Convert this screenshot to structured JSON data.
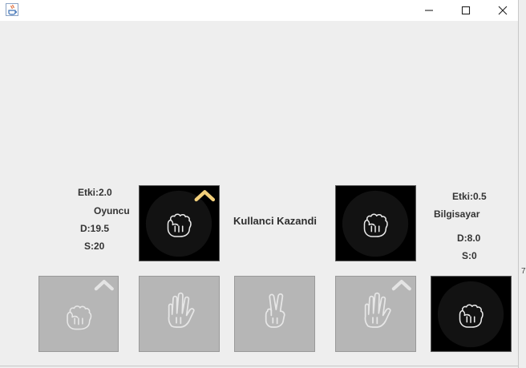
{
  "window": {
    "app_icon": "java-cup-icon",
    "controls": [
      "minimize-icon",
      "maximize-icon",
      "close-icon"
    ]
  },
  "player": {
    "effect": "Etki:2.0",
    "name": "Oyuncu",
    "durability": "D:19.5",
    "strength": "S:20",
    "card": "rock-hand-icon"
  },
  "computer": {
    "effect": "Etki:0.5",
    "name": "Bilgisayar",
    "durability": "D:8.0",
    "strength": "S:0",
    "card": "rock-hand-icon"
  },
  "result": "Kullanci Kazandi",
  "hand_cards": [
    {
      "icon": "rock-hand-icon",
      "upgraded": true,
      "enabled": false
    },
    {
      "icon": "paper-hand-icon",
      "upgraded": false,
      "enabled": false
    },
    {
      "icon": "scissors-hand-icon",
      "upgraded": false,
      "enabled": false
    },
    {
      "icon": "paper-hand-icon",
      "upgraded": true,
      "enabled": false
    },
    {
      "icon": "rock-hand-icon",
      "upgraded": false,
      "enabled": true
    }
  ],
  "colors": {
    "upgrade_chevron": "#f2cf7a",
    "card_active_bg": "#000000",
    "card_disabled_bg": "#b6b6b6"
  },
  "edge_glyph": "7"
}
